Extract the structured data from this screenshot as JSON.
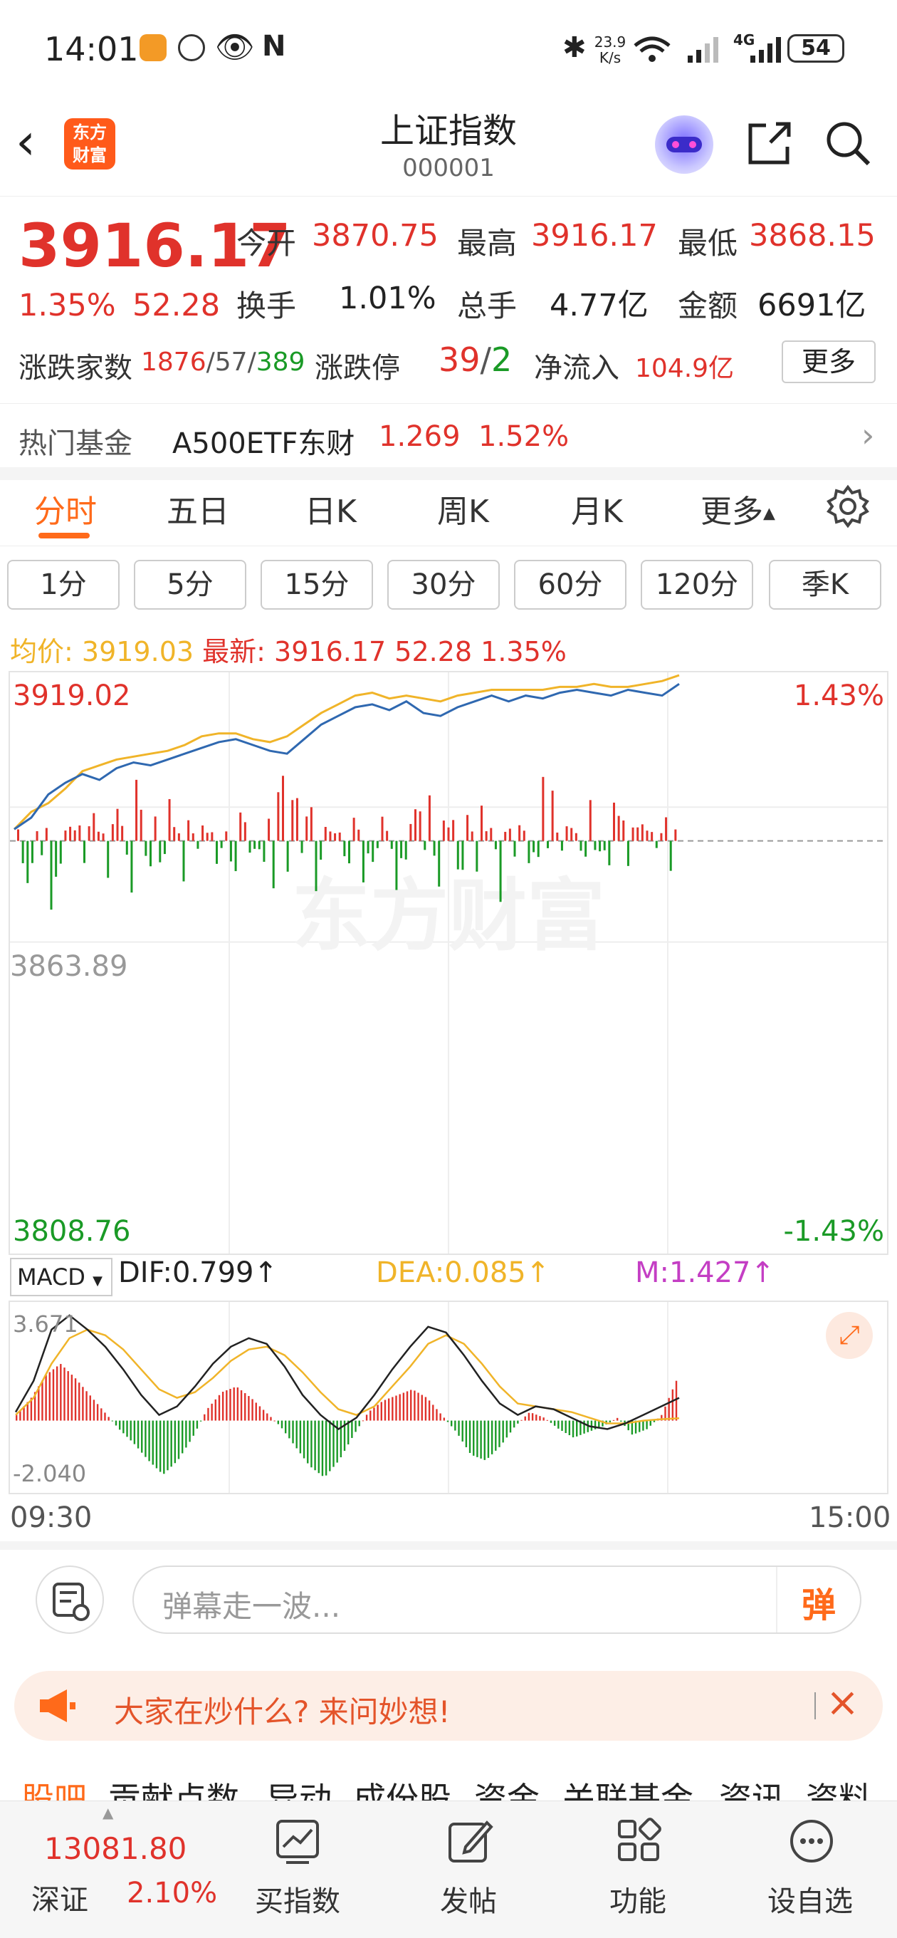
{
  "status_bar": {
    "time": "14:01",
    "net_speed_value": "23.9",
    "net_speed_unit": "K/s",
    "network": "4G",
    "battery": "54"
  },
  "header": {
    "title": "上证指数",
    "code": "000001",
    "logo_text_line1": "东方",
    "logo_text_line2": "财富"
  },
  "quote": {
    "price": "3916.17",
    "change_pct": "1.35%",
    "change_abs": "52.28",
    "open_label": "今开",
    "open": "3870.75",
    "high_label": "最高",
    "high": "3916.17",
    "low_label": "最低",
    "low": "3868.15",
    "turnover_label": "换手",
    "turnover": "1.01%",
    "volume_label": "总手",
    "volume": "4.77亿",
    "amount_label": "金额",
    "amount": "6691亿",
    "breadth_label": "涨跌家数",
    "breadth_up": "1876",
    "breadth_flat": "57",
    "breadth_down": "389",
    "limit_label": "涨跌停",
    "limit_up": "39",
    "limit_down": "2",
    "inflow_label": "净流入",
    "inflow": "104.9亿",
    "more_button": "更多"
  },
  "hot_fund": {
    "label": "热门基金",
    "name": "A500ETF东财",
    "price": "1.269",
    "pct": "1.52%"
  },
  "tabs": [
    "分时",
    "五日",
    "日K",
    "周K",
    "月K",
    "更多"
  ],
  "active_tab": "分时",
  "sub_tabs": [
    "1分",
    "5分",
    "15分",
    "30分",
    "60分",
    "120分",
    "季K"
  ],
  "info_line": {
    "avg_label": "均价:",
    "avg": "3919.03",
    "latest_label": "最新:",
    "latest": "3916.17",
    "change": "52.28",
    "pct": "1.35%"
  },
  "colors": {
    "up": "#e0322b",
    "down": "#1a9a26",
    "price_line": "#2f68b0",
    "avg_line": "#f0b429",
    "accent": "#ff6a1a",
    "dif_line": "#222222",
    "dea_line": "#f0b429"
  },
  "chart_data": [
    {
      "type": "line",
      "title": "",
      "y_top_label": "3919.02",
      "y_bottom_label": "3808.76",
      "pct_top_label": "1.43%",
      "pct_bottom_label": "-1.43%",
      "prev_close_label": "3863.89",
      "ylim": [
        3808.76,
        3919.02
      ],
      "x_start_label": "09:30",
      "x_end_label": "15:00",
      "watermark": "东方财富",
      "series": [
        {
          "values": [
            3866,
            3870,
            3878,
            3882,
            3885,
            3883,
            3887,
            3889,
            3888,
            3890,
            3892,
            3894,
            3896,
            3897,
            3895,
            3893,
            3892,
            3897,
            3902,
            3905,
            3908,
            3909,
            3907,
            3910,
            3906,
            3905,
            3908,
            3910,
            3912,
            3910,
            3912,
            3911,
            3913,
            3914,
            3913,
            3912,
            3914,
            3913,
            3912,
            3916
          ]
        },
        {
          "values": [
            3866,
            3872,
            3875,
            3880,
            3886,
            3888,
            3890,
            3891,
            3892,
            3893,
            3895,
            3898,
            3899,
            3899,
            3897,
            3896,
            3898,
            3902,
            3906,
            3909,
            3912,
            3913,
            3911,
            3912,
            3911,
            3910,
            3912,
            3913,
            3914,
            3914,
            3914,
            3914,
            3915,
            3915,
            3916,
            3915,
            3915,
            3916,
            3917,
            3919
          ]
        }
      ]
    },
    {
      "type": "bar",
      "title": "",
      "indicator": "MACD",
      "dif_label": "DIF:0.799",
      "dea_label": "DEA:0.085",
      "m_label": "M:1.427",
      "y_top_label": "3.671",
      "y_bottom_label": "-2.040",
      "ylim": [
        -2.04,
        3.671
      ],
      "values": [
        0.2,
        0.8,
        1.6,
        2.0,
        1.5,
        0.9,
        0.3,
        -0.3,
        -0.8,
        -1.4,
        -1.9,
        -1.4,
        -0.6,
        0.4,
        1.0,
        1.2,
        0.8,
        0.3,
        -0.2,
        -0.9,
        -1.6,
        -2.0,
        -1.4,
        -0.5,
        0.3,
        0.7,
        0.9,
        1.1,
        0.8,
        0.2,
        -0.4,
        -1.2,
        -1.4,
        -0.9,
        -0.2,
        0.3,
        0.1,
        -0.3,
        -0.6,
        -0.4,
        -0.2,
        0.1,
        -0.5,
        -0.3,
        0.2,
        1.4
      ],
      "dif": [
        0.3,
        1.4,
        3.2,
        3.7,
        3.2,
        2.6,
        1.8,
        0.9,
        0.2,
        0.5,
        1.2,
        2.0,
        2.6,
        2.9,
        2.7,
        1.9,
        0.9,
        0.2,
        -0.3,
        0.1,
        0.9,
        1.8,
        2.6,
        3.3,
        3.1,
        2.3,
        1.4,
        0.6,
        0.2,
        0.5,
        0.4,
        0.1,
        -0.2,
        -0.3,
        -0.1,
        0.2,
        0.5,
        0.8
      ],
      "dea": [
        0.2,
        0.8,
        2.0,
        2.9,
        3.2,
        3.0,
        2.5,
        1.8,
        1.1,
        0.8,
        1.0,
        1.5,
        2.1,
        2.5,
        2.6,
        2.3,
        1.7,
        1.0,
        0.4,
        0.2,
        0.5,
        1.2,
        1.9,
        2.7,
        3.0,
        2.7,
        2.0,
        1.2,
        0.6,
        0.5,
        0.4,
        0.3,
        0.1,
        -0.1,
        -0.1,
        0.0,
        0.05,
        0.085
      ]
    }
  ],
  "barrage": {
    "placeholder": "弹幕走一波...",
    "send_icon_text": "弹"
  },
  "ad": {
    "text": "大家在炒什么? 来问妙想!"
  },
  "bottom_tabs": [
    "股吧",
    "贡献点数",
    "异动",
    "成份股",
    "资金",
    "关联基金",
    "资讯",
    "资料"
  ],
  "footer": {
    "index_value": "13081.80",
    "index_name": "深证",
    "index_pct": "2.10%",
    "buy_label": "买指数",
    "post_label": "发帖",
    "func_label": "功能",
    "watch_label": "设自选"
  }
}
